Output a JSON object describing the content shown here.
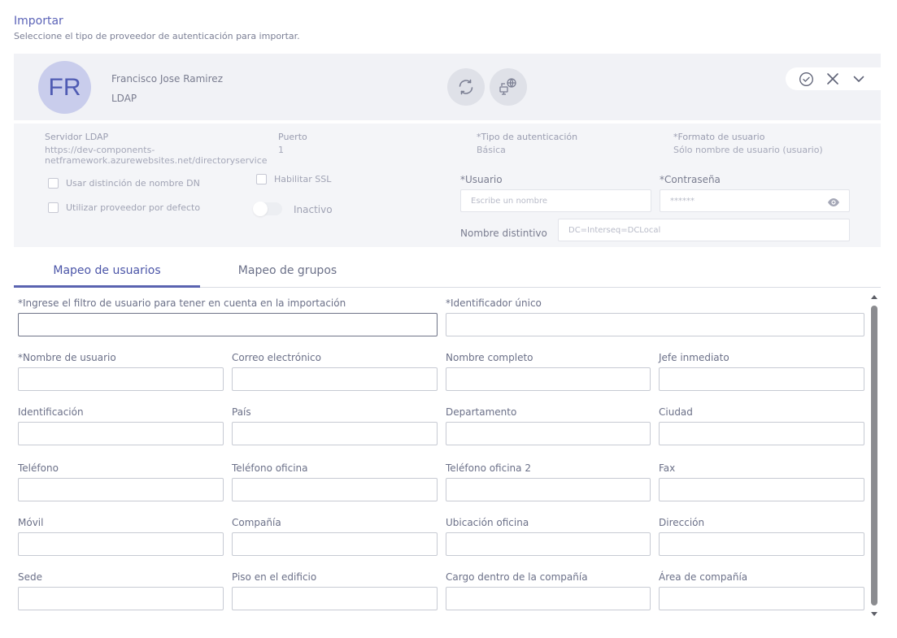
{
  "header": {
    "title": "Importar",
    "subtitle": "Seleccione el tipo de proveedor de autenticación para importar."
  },
  "provider": {
    "avatar_initials": "FR",
    "name": "Francisco Jose Ramirez",
    "type": "LDAP",
    "icons": [
      "sync-icon",
      "network-globe-icon",
      "check-circle-icon",
      "close-icon",
      "chevron-down-icon"
    ]
  },
  "details": {
    "server_label": "Servidor LDAP",
    "server_value_line1": "https://dev-components-",
    "server_value_line2": "netframework.azurewebsites.net/directoryservice",
    "port_label": "Puerto",
    "port_value": "1",
    "auth_type_label": "*Tipo de autenticación",
    "auth_type_value": "Básica",
    "user_format_label": "*Formato de usuario",
    "user_format_value": "Sólo nombre de usuario (usuario)",
    "dn_checkbox_label": "Usar distinción de nombre DN",
    "default_provider_checkbox_label": "Utilizar proveedor por defecto",
    "ssl_checkbox_label": "Habilitar SSL",
    "toggle_label": "Inactivo",
    "user_label": "*Usuario",
    "user_placeholder": "Escribe un nombre",
    "password_label": "*Contraseña",
    "password_value": "******",
    "dn_label": "Nombre distintivo",
    "dn_placeholder": "DC=Interseq=DCLocal"
  },
  "tabs": [
    {
      "label": "Mapeo de usuarios",
      "active": true
    },
    {
      "label": "Mapeo de grupos",
      "active": false
    }
  ],
  "mapping_fields": {
    "user_filter": "*Ingrese el filtro de usuario para tener en cuenta en la importación",
    "unique_id": "*Identificador único",
    "username": "*Nombre de usuario",
    "email": "Correo electrónico",
    "full_name": "Nombre completo",
    "manager": "Jefe inmediato",
    "identification": "Identificación",
    "country": "País",
    "department": "Departamento",
    "city": "Ciudad",
    "phone": "Teléfono",
    "office_phone": "Teléfono oficina",
    "office_phone_2": "Teléfono oficina 2",
    "fax": "Fax",
    "mobile": "Móvil",
    "company": "Compañía",
    "office_location": "Ubicación oficina",
    "address": "Dirección",
    "site": "Sede",
    "floor": "Piso en el edificio",
    "job_title": "Cargo dentro de la compañía",
    "company_area": "Área de compañía"
  },
  "colors": {
    "accent": "#5a63b0",
    "avatar_bg": "#c9cdec",
    "card_bg": "#f1f2f6"
  }
}
